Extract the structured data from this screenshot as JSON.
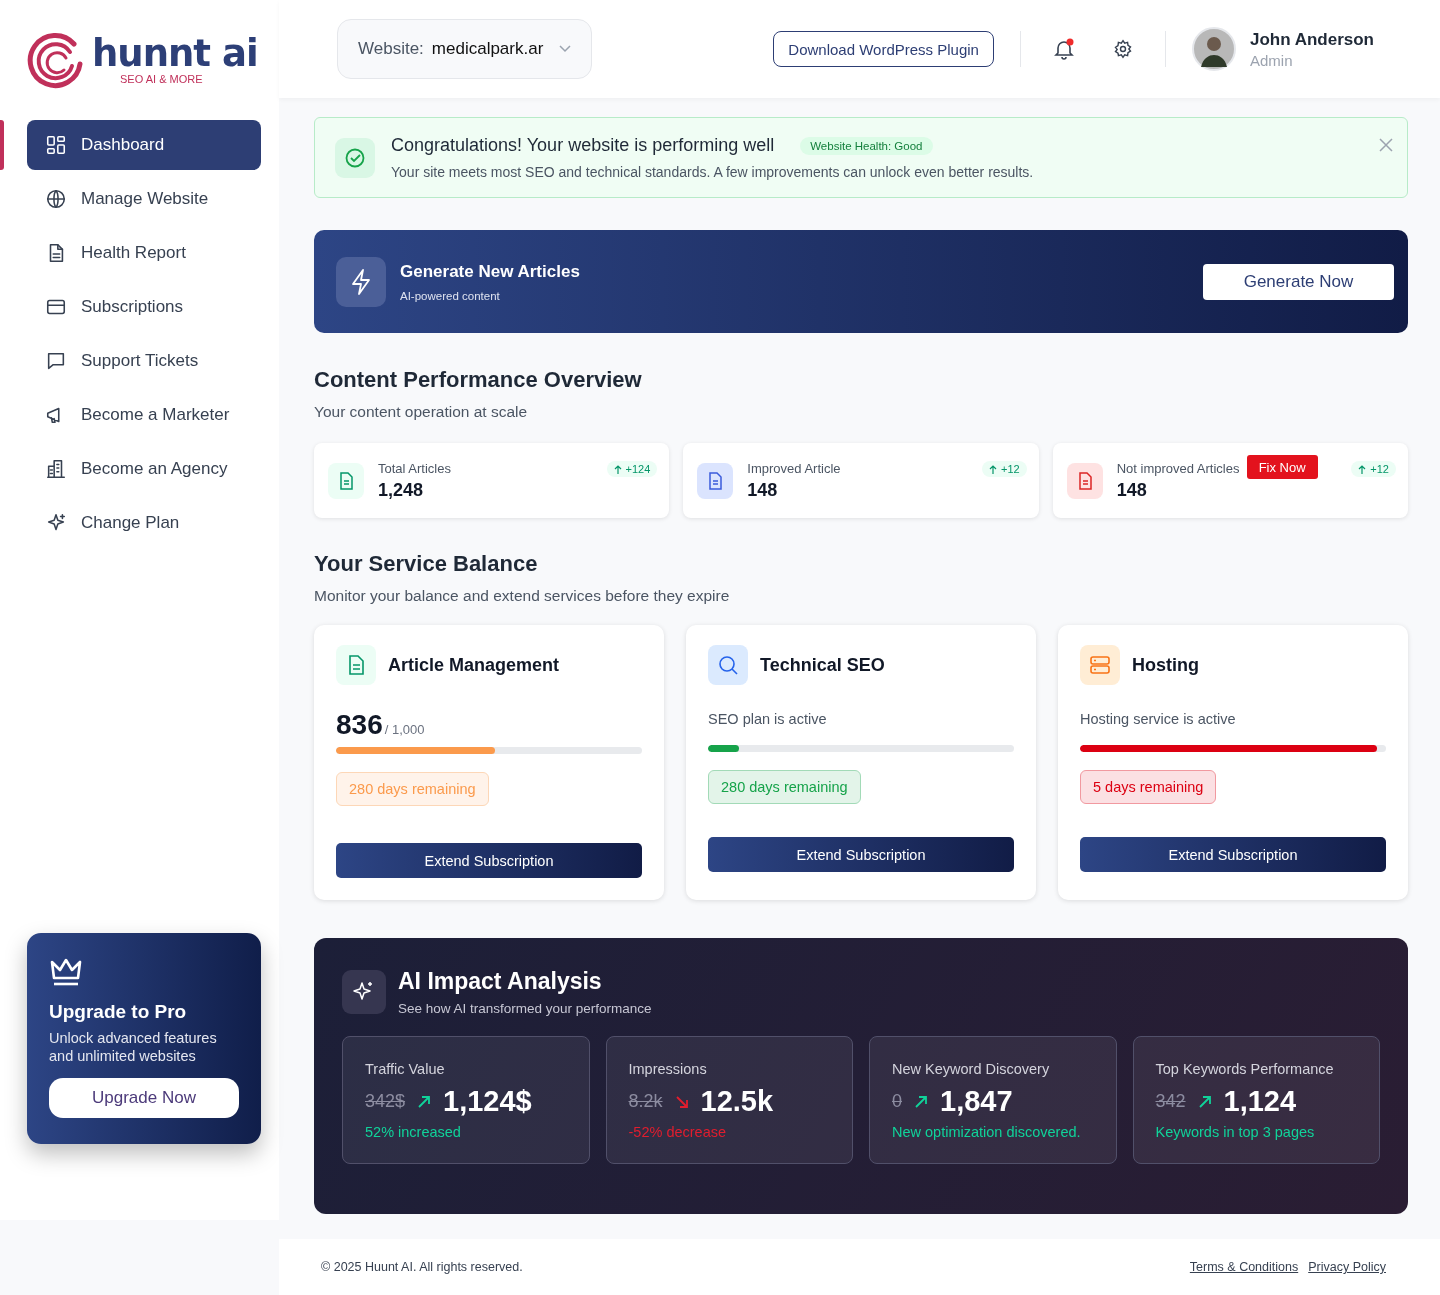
{
  "logo": {
    "name": "hunnt ai",
    "tagline": "SEO AI & MORE"
  },
  "sidebar": {
    "items": [
      {
        "label": "Dashboard",
        "selected": true
      },
      {
        "label": "Manage Website",
        "selected": false
      },
      {
        "label": "Health Report",
        "selected": false
      },
      {
        "label": "Subscriptions",
        "selected": false
      },
      {
        "label": "Support Tickets",
        "selected": false
      },
      {
        "label": "Become a Marketer",
        "selected": false
      },
      {
        "label": "Become an Agency",
        "selected": false
      },
      {
        "label": "Change Plan",
        "selected": false
      }
    ],
    "upgrade": {
      "title": "Upgrade to Pro",
      "text": "Unlock advanced features and unlimited websites",
      "button": "Upgrade Now"
    }
  },
  "header": {
    "website_label": "Website:",
    "website_value": "medicalpark.ar",
    "plugin_button": "Download WordPress Plugin",
    "notifications_unread": true,
    "user": {
      "name": "John Anderson",
      "role": "Admin"
    }
  },
  "alert": {
    "title": "Congratulations! Your website is performing well",
    "badge": "Website Health: Good",
    "text": "Your site meets most SEO and technical standards. A few improvements can unlock even better results."
  },
  "banner": {
    "title": "Generate New Articles",
    "subtitle": "AI-powered content",
    "button": "Generate Now"
  },
  "overview": {
    "title": "Content Performance Overview",
    "subtitle": "Your content operation at scale",
    "stats": [
      {
        "label": "Total Articles",
        "value": "1,248",
        "change": "+124"
      },
      {
        "label": "Improved Article",
        "value": "148",
        "change": "+12"
      },
      {
        "label": "Not improved Articles",
        "value": "148",
        "change": "+12",
        "action": "Fix Now"
      }
    ]
  },
  "balance": {
    "title": "Your Service Balance",
    "subtitle": "Monitor your balance and extend services before they expire",
    "services": [
      {
        "kind": "count",
        "title": "Article Management",
        "value": "836",
        "total": "/ 1,000",
        "level": 0.52,
        "color": "#fb9a4c",
        "remaining": "280 days remaining",
        "button": "Extend Subscription"
      },
      {
        "kind": "status",
        "title": "Technical SEO",
        "status": "SEO plan is active",
        "level": 0.1,
        "color": "#16a34a",
        "remaining": "280 days remaining",
        "button": "Extend Subscription"
      },
      {
        "kind": "status",
        "title": "Hosting",
        "status": "Hosting service is active",
        "level": 0.97,
        "color": "#dc0012",
        "remaining": "5 days remaining",
        "button": "Extend Subscription"
      }
    ]
  },
  "ai_impact": {
    "title": "AI Impact Analysis",
    "subtitle": "See how AI transformed your performance",
    "metrics": [
      {
        "label": "Traffic Value",
        "old": "342$",
        "new": "1,124$",
        "kind": "increase",
        "color": "#10d39a",
        "note": "52% increased"
      },
      {
        "label": "Impressions",
        "old": "8.2k",
        "new": "12.5k",
        "kind": "decrease",
        "color": "#e11d2e",
        "note": "-52% decrease"
      },
      {
        "label": "New Keyword Discovery",
        "old": "0",
        "new": "1,847",
        "kind": "increase",
        "color": "#10d39a",
        "note": "New optimization discovered."
      },
      {
        "label": "Top Keywords Performance",
        "old": "342",
        "new": "1,124",
        "kind": "increase",
        "color": "#10d39a",
        "note": "Keywords in top 3 pages"
      }
    ]
  },
  "footer": {
    "copyright": "© 2025 Huunt AI. All rights reserved.",
    "links": [
      "Terms & Conditions",
      "Privacy Policy"
    ]
  }
}
